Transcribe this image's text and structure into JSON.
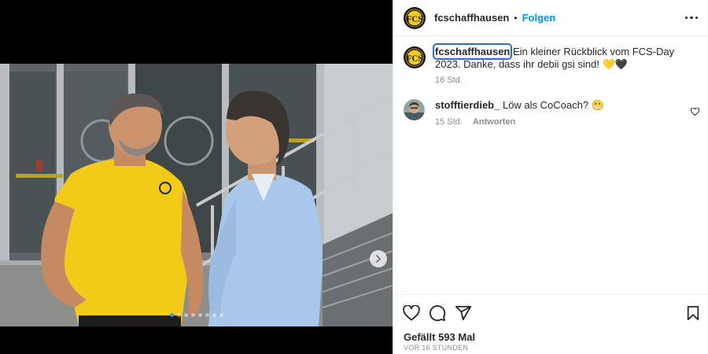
{
  "colors": {
    "accent_blue": "#0095f6",
    "brand_yellow": "#f5cc1c",
    "focus_outline": "#2c6bd6"
  },
  "header": {
    "username": "fcschaffhausen",
    "separator": "•",
    "follow_label": "Folgen",
    "more_icon": "more-horizontal-icon"
  },
  "logo": {
    "letters": "FCS"
  },
  "caption": {
    "username": "fcschaffhausen",
    "text": "Ein kleiner Rückblick vom FCS-Day 2023. Danke, dass ihr debii gsi sind! 💛🖤",
    "time": "16 Std."
  },
  "comments": [
    {
      "username": "stofftierdieb_",
      "text": "Löw als CoCoach? 😬",
      "time": "15 Std.",
      "reply_label": "Antworten"
    }
  ],
  "carousel": {
    "count": 8,
    "active_index": 0,
    "next_icon": "chevron-right-icon"
  },
  "actions": {
    "like_icon": "heart-icon",
    "comment_icon": "comment-icon",
    "share_icon": "send-icon",
    "save_icon": "bookmark-icon"
  },
  "likes_text": "Gefällt 593 Mal",
  "time_ago": "VOR 16 STUNDEN"
}
